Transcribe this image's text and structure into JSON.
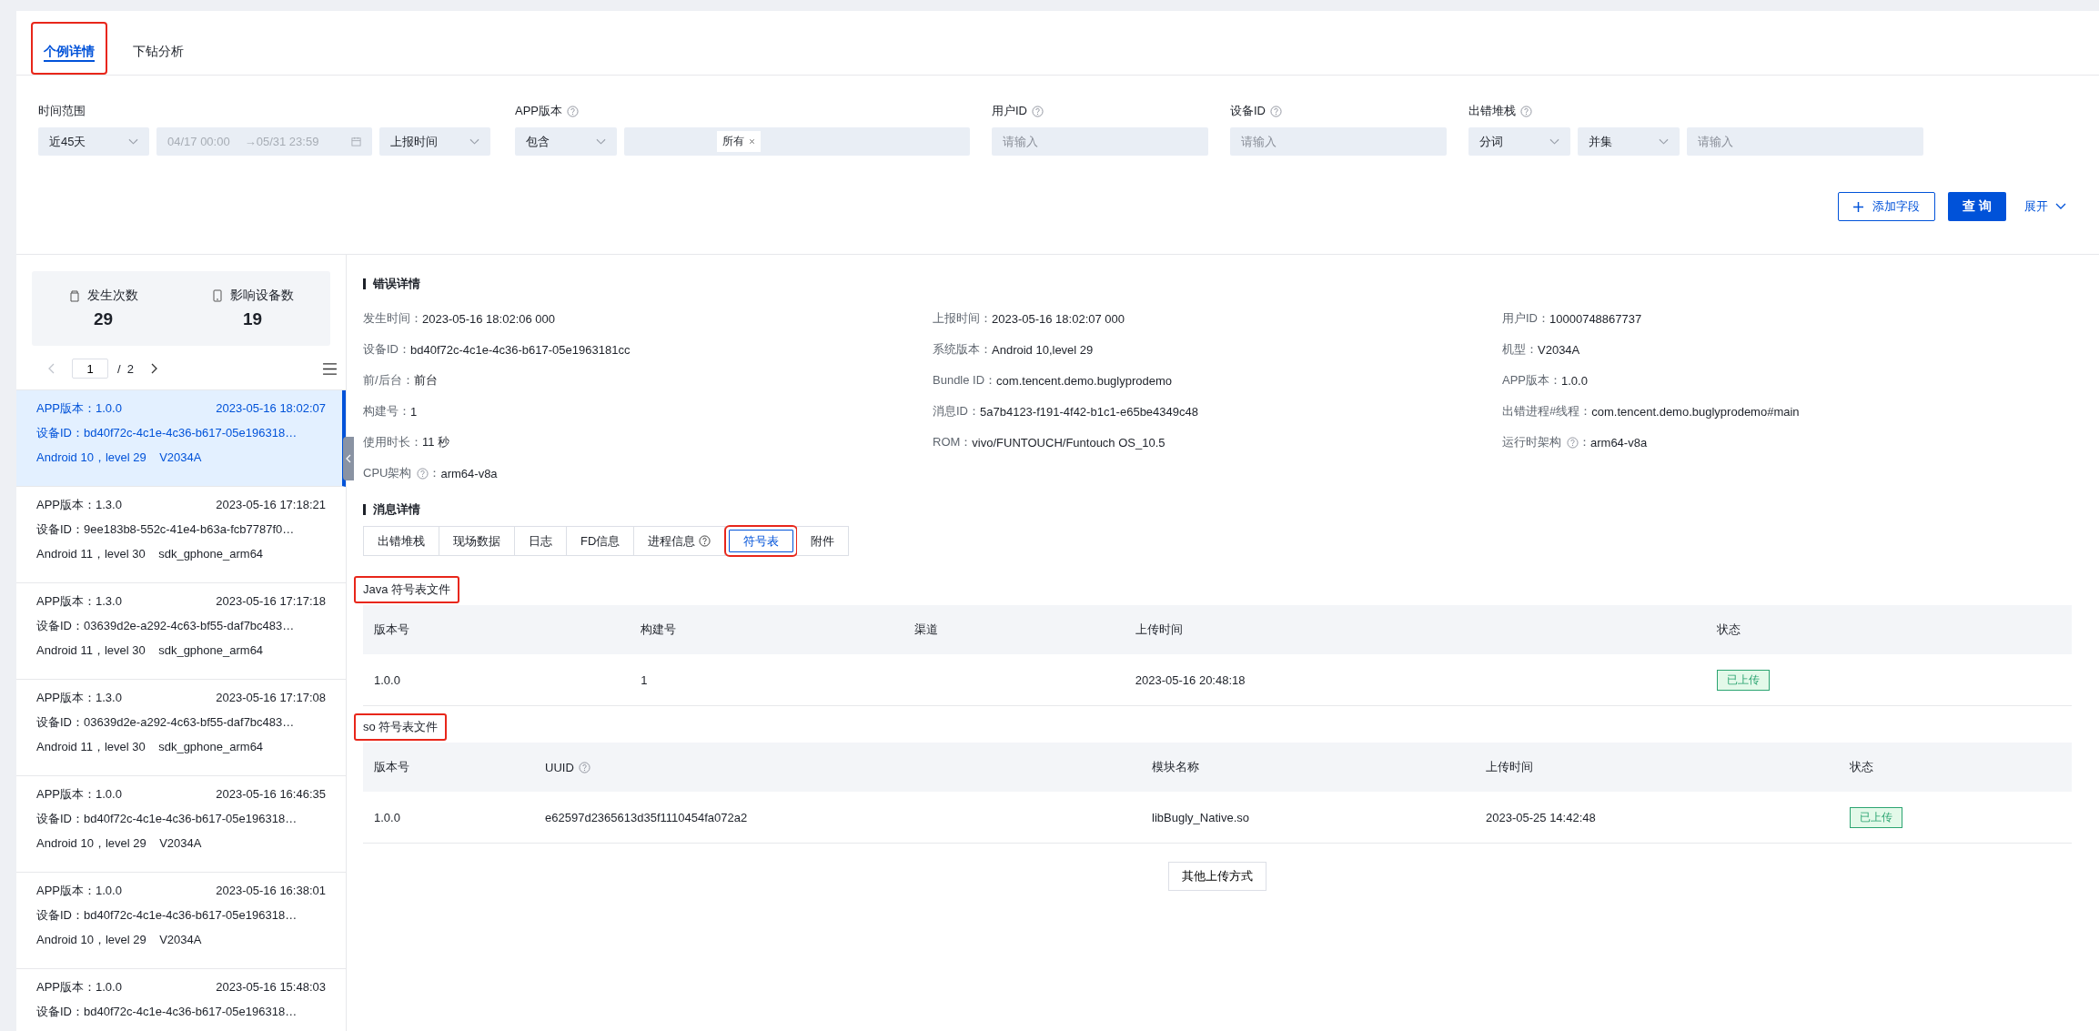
{
  "tabs": [
    {
      "label": "个例详情",
      "selected": true,
      "highlighted": true
    },
    {
      "label": "下钻分析",
      "selected": false,
      "highlighted": false
    }
  ],
  "filters": [
    {
      "label": "时间范围",
      "help": false,
      "controls": [
        {
          "kind": "select",
          "value": "近45天"
        },
        {
          "kind": "date",
          "start": "04/17 00:00",
          "end": "→05/31 23:59"
        },
        {
          "kind": "select",
          "value": "上报时间"
        }
      ]
    },
    {
      "label": "APP版本",
      "help": true,
      "controls": [
        {
          "kind": "select",
          "value": "包含"
        },
        {
          "kind": "tags",
          "tags": [
            "所有"
          ]
        }
      ]
    },
    {
      "label": "用户ID",
      "help": true,
      "controls": [
        {
          "kind": "input",
          "placeholder": "请输入"
        }
      ]
    },
    {
      "label": "设备ID",
      "help": true,
      "controls": [
        {
          "kind": "input",
          "placeholder": "请输入"
        }
      ]
    },
    {
      "label": "出错堆栈",
      "help": true,
      "controls": [
        {
          "kind": "select",
          "value": "分词"
        },
        {
          "kind": "select",
          "value": "并集"
        },
        {
          "kind": "input",
          "placeholder": "请输入"
        }
      ]
    }
  ],
  "actions": {
    "add_field": "添加字段",
    "query": "查 询",
    "expand": "展开"
  },
  "stats": [
    {
      "kind": "cup",
      "label": "发生次数",
      "value": "29"
    },
    {
      "kind": "phone",
      "label": "影响设备数",
      "value": "19"
    }
  ],
  "pagination": {
    "page": "1",
    "total": "/  2"
  },
  "cases": [
    {
      "version": "APP版本：1.0.0",
      "time": "2023-05-16 18:02:07",
      "device": "设备ID：bd40f72c-4c1e-4c36-b617-05e196318…",
      "system": "Android 10，level 29    V2034A",
      "selected": true
    },
    {
      "version": "APP版本：1.3.0",
      "time": "2023-05-16 17:18:21",
      "device": "设备ID：9ee183b8-552c-41e4-b63a-fcb7787f0…",
      "system": "Android 11，level 30    sdk_gphone_arm64",
      "selected": false
    },
    {
      "version": "APP版本：1.3.0",
      "time": "2023-05-16 17:17:18",
      "device": "设备ID：03639d2e-a292-4c63-bf55-daf7bc483…",
      "system": "Android 11，level 30    sdk_gphone_arm64",
      "selected": false
    },
    {
      "version": "APP版本：1.3.0",
      "time": "2023-05-16 17:17:08",
      "device": "设备ID：03639d2e-a292-4c63-bf55-daf7bc483…",
      "system": "Android 11，level 30    sdk_gphone_arm64",
      "selected": false
    },
    {
      "version": "APP版本：1.0.0",
      "time": "2023-05-16 16:46:35",
      "device": "设备ID：bd40f72c-4c1e-4c36-b617-05e196318…",
      "system": "Android 10，level 29    V2034A",
      "selected": false
    },
    {
      "version": "APP版本：1.0.0",
      "time": "2023-05-16 16:38:01",
      "device": "设备ID：bd40f72c-4c1e-4c36-b617-05e196318…",
      "system": "Android 10，level 29    V2034A",
      "selected": false
    },
    {
      "version": "APP版本：1.0.0",
      "time": "2023-05-16 15:48:03",
      "device": "设备ID：bd40f72c-4c1e-4c36-b617-05e196318…",
      "selected": false
    }
  ],
  "error_details": {
    "title": "错误详情",
    "columns": [
      [
        {
          "label": "发生时间：",
          "value": "2023-05-16 18:02:06 000",
          "help": false
        },
        {
          "label": "设备ID：",
          "value": "bd40f72c-4c1e-4c36-b617-05e1963181cc",
          "help": false
        },
        {
          "label": "前/后台：",
          "value": "前台",
          "help": false
        },
        {
          "label": "构建号：",
          "value": "1",
          "help": false
        },
        {
          "label": "使用时长：",
          "value": "11 秒",
          "help": false
        },
        {
          "label": "CPU架构",
          "suffix": "：",
          "value": "arm64-v8a",
          "help": true
        }
      ],
      [
        {
          "label": "上报时间：",
          "value": "2023-05-16 18:02:07 000",
          "help": false
        },
        {
          "label": "系统版本：",
          "value": "Android 10,level 29",
          "help": false
        },
        {
          "label": "Bundle ID：",
          "value": "com.tencent.demo.buglyprodemo",
          "help": false
        },
        {
          "label": "消息ID：",
          "value": "5a7b4123-f191-4f42-b1c1-e65be4349c48",
          "help": false
        },
        {
          "label": "ROM：",
          "value": "vivo/FUNTOUCH/Funtouch OS_10.5",
          "help": false
        }
      ],
      [
        {
          "label": "用户ID：",
          "value": "10000748867737",
          "help": false
        },
        {
          "label": "机型：",
          "value": "V2034A",
          "help": false
        },
        {
          "label": "APP版本：",
          "value": "1.0.0",
          "help": false
        },
        {
          "label": "出错进程#线程：",
          "value": "com.tencent.demo.buglyprodemo#main",
          "help": false
        },
        {
          "label": "运行时架构",
          "suffix": "：",
          "value": "arm64-v8a",
          "help": true
        }
      ]
    ]
  },
  "message_details": {
    "title": "消息详情",
    "tabs": [
      {
        "label": "出错堆栈",
        "help": false,
        "selected": false,
        "highlighted": false
      },
      {
        "label": "现场数据",
        "help": false,
        "selected": false,
        "highlighted": false
      },
      {
        "label": "日志",
        "help": false,
        "selected": false,
        "highlighted": false
      },
      {
        "label": "FD信息",
        "help": false,
        "selected": false,
        "highlighted": false
      },
      {
        "label": "进程信息",
        "help": true,
        "selected": false,
        "highlighted": false
      },
      {
        "label": "符号表",
        "help": false,
        "selected": true,
        "highlighted": true
      },
      {
        "label": "附件",
        "help": false,
        "selected": false,
        "highlighted": false
      }
    ]
  },
  "symbol_tables": [
    {
      "title": "Java 符号表文件",
      "highlighted": true,
      "columns": [
        {
          "label": "版本号",
          "help": false,
          "kind": "text"
        },
        {
          "label": "构建号",
          "help": false,
          "kind": "text"
        },
        {
          "label": "渠道",
          "help": false,
          "kind": "text"
        },
        {
          "label": "上传时间",
          "help": false,
          "kind": "text"
        },
        {
          "label": "状态",
          "help": false,
          "kind": "status"
        }
      ],
      "rows": [
        [
          "1.0.0",
          "1",
          "",
          "2023-05-16 20:48:18",
          "已上传"
        ]
      ]
    },
    {
      "title": "so 符号表文件",
      "highlighted": true,
      "columns": [
        {
          "label": "版本号",
          "help": false,
          "kind": "text"
        },
        {
          "label": "UUID",
          "help": true,
          "kind": "text"
        },
        {
          "label": "模块名称",
          "help": false,
          "kind": "text"
        },
        {
          "label": "上传时间",
          "help": false,
          "kind": "text"
        },
        {
          "label": "状态",
          "help": false,
          "kind": "status"
        }
      ],
      "rows": [
        [
          "1.0.0",
          "e62597d2365613d35f1110454fa072a2",
          "libBugly_Native.so",
          "2023-05-25 14:42:48",
          "已上传"
        ]
      ]
    }
  ],
  "other_upload": "其他上传方式"
}
